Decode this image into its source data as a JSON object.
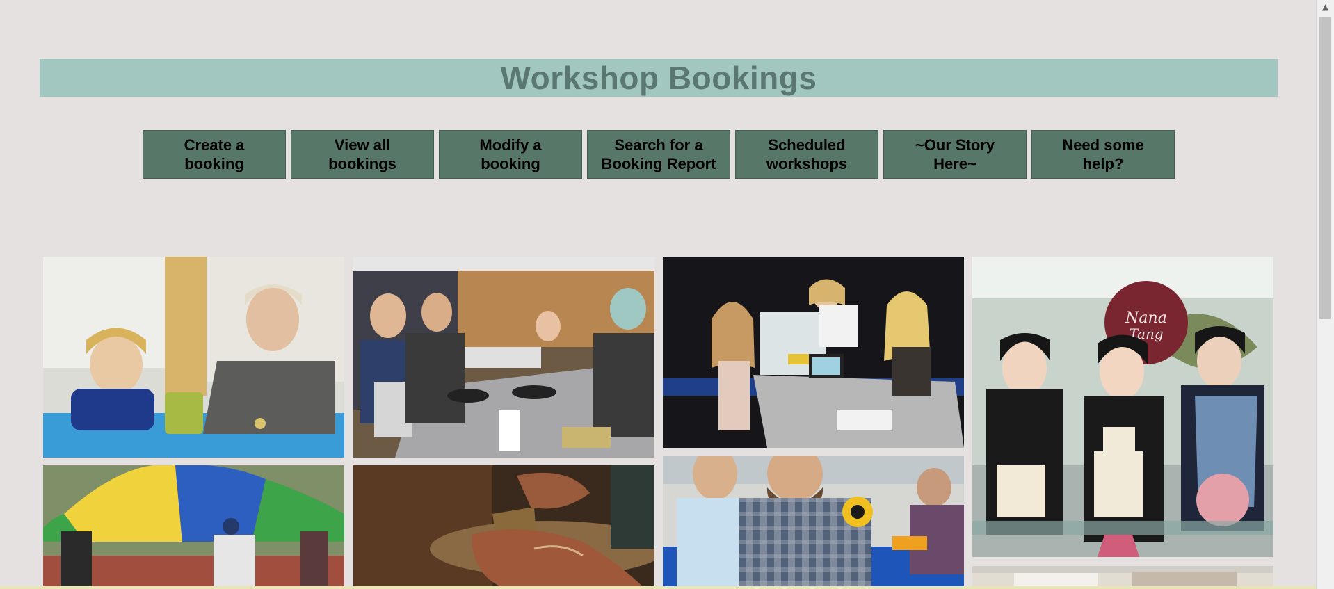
{
  "header": {
    "title": "Workshop Bookings"
  },
  "nav": {
    "items": [
      {
        "label": "Create a\nbooking"
      },
      {
        "label": "View all\nbookings"
      },
      {
        "label": "Modify a\nbooking"
      },
      {
        "label": "Search for a\nBooking Report"
      },
      {
        "label": "Scheduled\nworkshops"
      },
      {
        "label": "~Our Story\nHere~"
      },
      {
        "label": "Need some\nhelp?"
      }
    ]
  },
  "gallery": {
    "photos": [
      {
        "name": "photo-classroom-toys",
        "sign_text": ""
      },
      {
        "name": "photo-cooking-class"
      },
      {
        "name": "photo-kids-stop-motion"
      },
      {
        "name": "photo-cake-decorating",
        "sign_text": "Nana Tang"
      },
      {
        "name": "photo-parachute-game"
      },
      {
        "name": "photo-pottery-wheel"
      },
      {
        "name": "photo-soldering-workshop"
      },
      {
        "name": "photo-kitchen-partial"
      }
    ]
  },
  "colors": {
    "background": "#e5e1e1",
    "banner": "#a2c7c0",
    "banner_text": "#5b7772",
    "nav_button": "#577768"
  }
}
